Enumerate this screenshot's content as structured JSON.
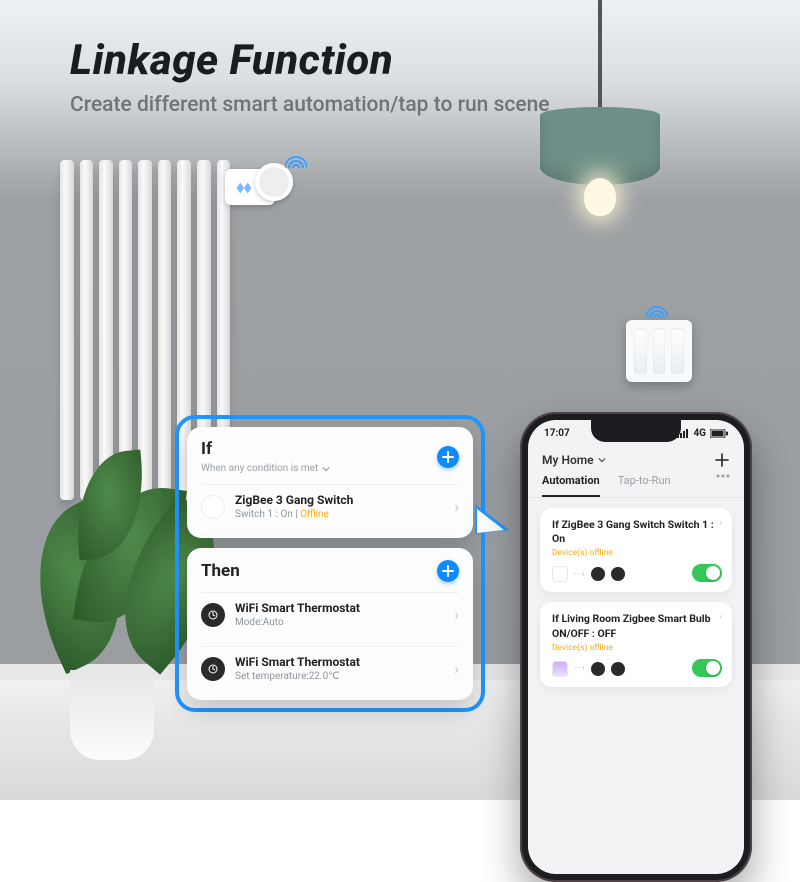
{
  "heading": {
    "title": "Linkage Function",
    "subtitle": "Create different smart automation/tap to run scene"
  },
  "popup": {
    "if": {
      "label": "If",
      "condition_hint": "When any condition is met",
      "item": {
        "title": "ZigBee 3 Gang Switch",
        "sub_prefix": "Switch 1 : On",
        "sub_divider": " | ",
        "offline": "Offline"
      }
    },
    "then": {
      "label": "Then",
      "items": [
        {
          "title": "WiFi Smart Thermostat",
          "sub": "Mode:Auto"
        },
        {
          "title": "WiFi Smart Thermostat",
          "sub": "Set temperature:22.0℃"
        }
      ]
    }
  },
  "phone": {
    "status": {
      "time": "17:07",
      "net": "4G"
    },
    "header": {
      "home": "My Home"
    },
    "tabs": {
      "automation": "Automation",
      "tap": "Tap-to-Run"
    },
    "autos": [
      {
        "title": "If ZigBee 3 Gang Switch Switch 1 : On",
        "warn": "Device(s) offline",
        "bulb": false
      },
      {
        "title": "If  Living Room Zigbee Smart Bulb ON/OFF : OFF",
        "warn": "Device(s) offline",
        "bulb": true
      }
    ]
  }
}
